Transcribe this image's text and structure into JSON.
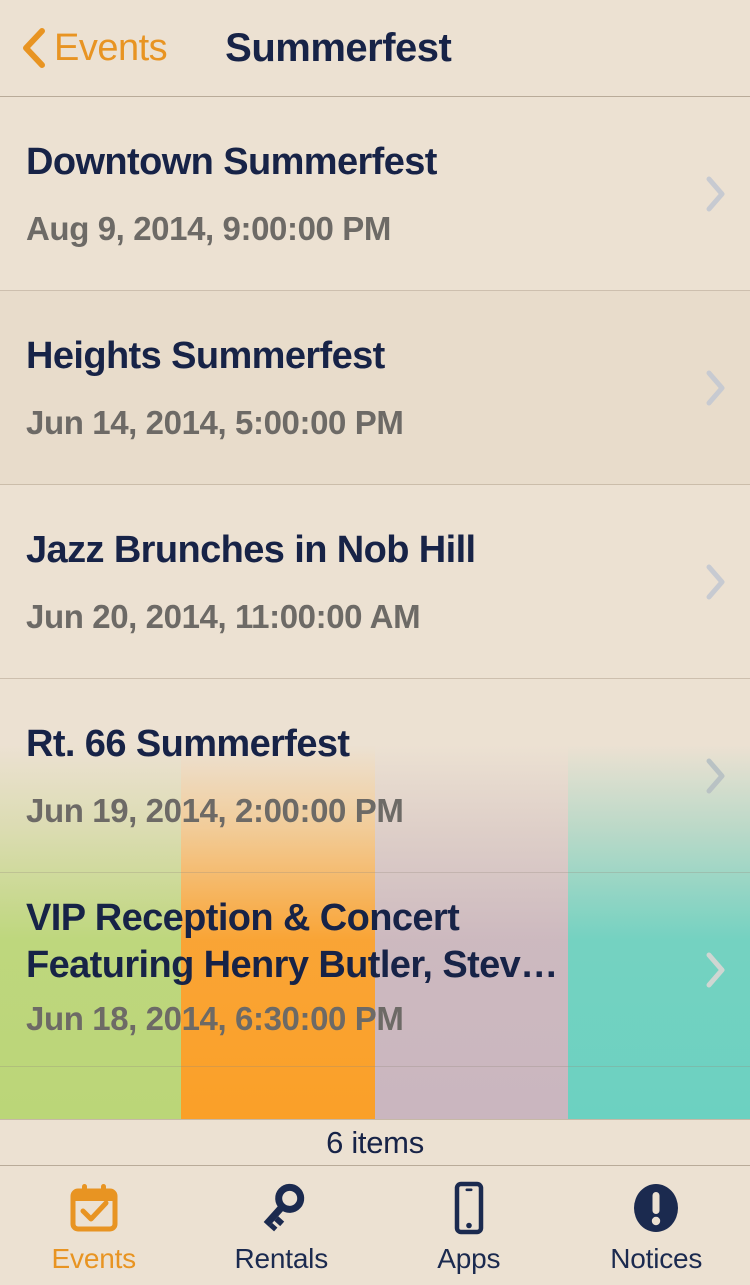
{
  "navbar": {
    "back_label": "Events",
    "back_icon": "chevron-left-icon",
    "title": "Summerfest"
  },
  "list": {
    "rows": [
      {
        "title": "Downtown Summerfest",
        "date": "Aug 9, 2014, 9:00:00 PM",
        "accessory": "chevron-right-icon"
      },
      {
        "title": "Heights Summerfest",
        "date": "Jun 14, 2014, 5:00:00 PM",
        "accessory": "chevron-right-icon"
      },
      {
        "title": "Jazz Brunches in Nob Hill",
        "date": "Jun 20, 2014, 11:00:00 AM",
        "accessory": "chevron-right-icon"
      },
      {
        "title": "Rt. 66 Summerfest",
        "date": "Jun 19, 2014, 2:00:00 PM",
        "accessory": "chevron-right-icon"
      },
      {
        "title": "VIP Reception & Concert Featuring Henry Butler, Stev…",
        "date": "Jun 18, 2014, 6:30:00 PM",
        "accessory": "chevron-right-icon"
      }
    ]
  },
  "footer": {
    "count_label": "6 items"
  },
  "tabbar": {
    "tabs": [
      {
        "label": "Events",
        "icon": "calendar-check-icon",
        "active": true
      },
      {
        "label": "Rentals",
        "icon": "key-icon",
        "active": false
      },
      {
        "label": "Apps",
        "icon": "smartphone-icon",
        "active": false
      },
      {
        "label": "Notices",
        "icon": "exclamation-circle-icon",
        "active": false
      }
    ]
  },
  "colors": {
    "background": "#ece1d2",
    "accent": "#e89422",
    "title_text": "#172347",
    "subtitle_text": "#6d6a66",
    "chevron": "#c7cad1",
    "separator": "#b9ab99",
    "photo_band_green": "#bbd678",
    "photo_band_orange": "#faa028",
    "photo_band_mauve": "#cab6bf",
    "photo_band_teal": "#6cd1c1"
  }
}
